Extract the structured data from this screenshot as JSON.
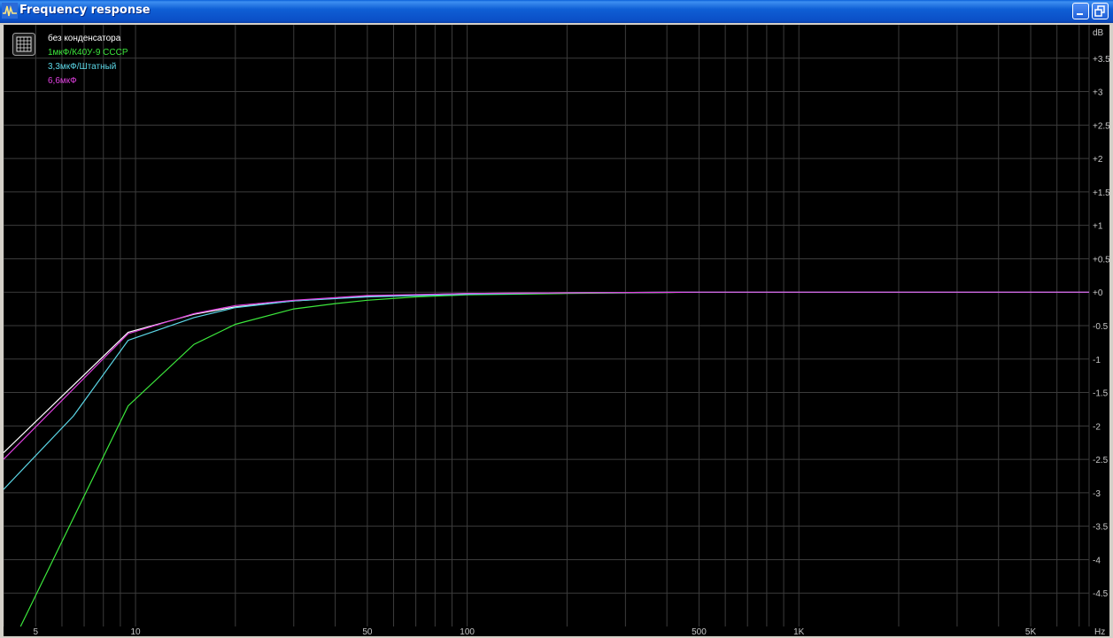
{
  "window": {
    "title": "Frequency response",
    "icon": "waveform-icon",
    "buttons": [
      "minimize-icon",
      "restore-icon"
    ]
  },
  "colors": {
    "background": "#000000",
    "grid": "#3c3c3c",
    "axis_text": "#c8c8c8",
    "titlebar": "#0b55d0"
  },
  "chart_data": {
    "type": "line",
    "title": "",
    "xlabel": "Hz",
    "ylabel": "dB",
    "x_scale": "log",
    "xlim": [
      4,
      7500
    ],
    "ylim": [
      -5,
      4
    ],
    "grid": true,
    "legend_placement": "top-left",
    "x_ticks": [
      {
        "value": 5,
        "label": "5"
      },
      {
        "value": 10,
        "label": "10"
      },
      {
        "value": 50,
        "label": "50"
      },
      {
        "value": 100,
        "label": "100"
      },
      {
        "value": 500,
        "label": "500"
      },
      {
        "value": 1000,
        "label": "1K"
      },
      {
        "value": 5000,
        "label": "5K"
      }
    ],
    "y_ticks": [
      {
        "value": 3.5,
        "label": "+3.5"
      },
      {
        "value": 3,
        "label": "+3"
      },
      {
        "value": 2.5,
        "label": "+2.5"
      },
      {
        "value": 2,
        "label": "+2"
      },
      {
        "value": 1.5,
        "label": "+1.5"
      },
      {
        "value": 1,
        "label": "+1"
      },
      {
        "value": 0.5,
        "label": "+0.5"
      },
      {
        "value": 0,
        "label": "+0"
      },
      {
        "value": -0.5,
        "label": "-0.5"
      },
      {
        "value": -1,
        "label": "-1"
      },
      {
        "value": -1.5,
        "label": "-1.5"
      },
      {
        "value": -2,
        "label": "-2"
      },
      {
        "value": -2.5,
        "label": "-2.5"
      },
      {
        "value": -3,
        "label": "-3"
      },
      {
        "value": -3.5,
        "label": "-3.5"
      },
      {
        "value": -4,
        "label": "-4"
      },
      {
        "value": -4.5,
        "label": "-4.5"
      }
    ],
    "series": [
      {
        "name": "без конденсатора",
        "color": "#ffffff",
        "x": [
          4,
          9.5,
          15,
          20,
          30,
          50,
          100,
          200,
          500,
          1000,
          2000,
          5000,
          7500
        ],
        "y": [
          -2.4,
          -0.6,
          -0.33,
          -0.22,
          -0.13,
          -0.06,
          -0.02,
          -0.01,
          0.0,
          0.0,
          0.0,
          0.0,
          0.0
        ]
      },
      {
        "name": "1мкФ/К40У-9 СССР",
        "color": "#3ce83c",
        "x": [
          4.5,
          9.5,
          15,
          20,
          30,
          40,
          50,
          70,
          100,
          200,
          500,
          1000,
          2000,
          5000,
          7500
        ],
        "y": [
          -5.0,
          -1.7,
          -0.78,
          -0.48,
          -0.25,
          -0.17,
          -0.12,
          -0.07,
          -0.04,
          -0.02,
          0.0,
          0.0,
          0.0,
          0.0,
          0.0
        ]
      },
      {
        "name": "3,3мкФ/Штатный",
        "color": "#5cd8e8",
        "x": [
          4,
          6.5,
          9.5,
          15,
          20,
          30,
          50,
          100,
          200,
          500,
          1000,
          2000,
          5000,
          7500
        ],
        "y": [
          -2.95,
          -1.85,
          -0.72,
          -0.38,
          -0.23,
          -0.13,
          -0.07,
          -0.03,
          -0.01,
          0.0,
          0.0,
          0.0,
          0.0,
          0.0
        ]
      },
      {
        "name": "6,6мкФ",
        "color": "#e040e0",
        "x": [
          4,
          9.5,
          15,
          20,
          30,
          50,
          100,
          200,
          500,
          1000,
          2000,
          5000,
          7500
        ],
        "y": [
          -2.5,
          -0.62,
          -0.32,
          -0.2,
          -0.12,
          -0.05,
          -0.02,
          -0.01,
          0.0,
          0.0,
          0.0,
          0.0,
          0.0
        ]
      }
    ]
  }
}
